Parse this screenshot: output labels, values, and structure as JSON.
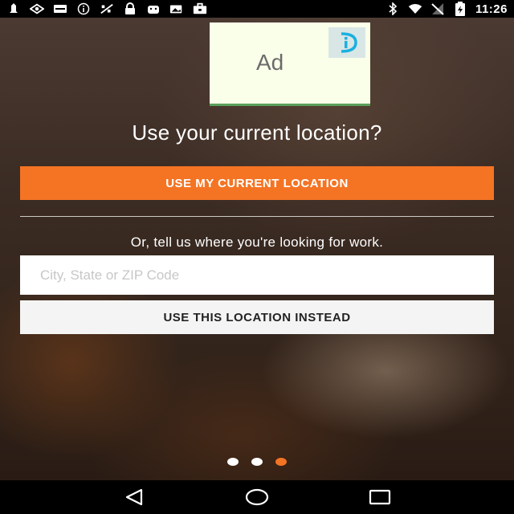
{
  "status_bar": {
    "time": "11:26",
    "left_icons": [
      "notification-icon",
      "location-icon",
      "card-icon",
      "info-icon",
      "no-signal-icon",
      "lock-icon",
      "android-icon",
      "photo-icon",
      "briefcase-icon"
    ],
    "right_icons": [
      "bluetooth-icon",
      "wifi-icon",
      "no-sim-icon",
      "battery-icon"
    ]
  },
  "ad": {
    "label": "Ad"
  },
  "main": {
    "headline": "Use your current location?",
    "use_current_button": "USE MY CURRENT LOCATION",
    "alternate_prompt": "Or, tell us where you're looking for work.",
    "location_input": {
      "value": "",
      "placeholder": "City, State or ZIP Code"
    },
    "use_this_button": "USE THIS LOCATION INSTEAD"
  },
  "pager": {
    "count": 3,
    "active_index": 2,
    "active_color": "#f47424",
    "inactive_color": "#ffffff"
  },
  "colors": {
    "accent": "#f47424",
    "secondary_button_bg": "#f4f4f4"
  },
  "navigation": {
    "icons": [
      "back-icon",
      "home-icon",
      "recents-icon"
    ]
  }
}
